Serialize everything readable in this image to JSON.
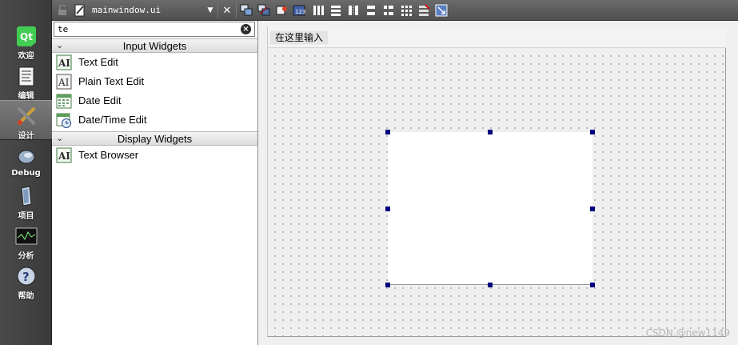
{
  "modes": [
    {
      "label": "欢迎",
      "icon": "qt-logo-icon"
    },
    {
      "label": "编辑",
      "icon": "document-icon"
    },
    {
      "label": "设计",
      "icon": "design-tools-icon"
    },
    {
      "label": "Debug",
      "icon": "bug-icon"
    },
    {
      "label": "项目",
      "icon": "project-icon"
    },
    {
      "label": "分析",
      "icon": "oscilloscope-icon"
    },
    {
      "label": "帮助",
      "icon": "help-icon"
    }
  ],
  "toolbar": {
    "document_name": "mainwindow.ui",
    "close_label": "✕"
  },
  "widgetbox": {
    "filter_value": "te",
    "categories": [
      {
        "label": "Input Widgets",
        "items": [
          {
            "label": "Text Edit",
            "icon": "text-edit-icon"
          },
          {
            "label": "Plain Text Edit",
            "icon": "plain-text-edit-icon"
          },
          {
            "label": "Date Edit",
            "icon": "date-edit-icon"
          },
          {
            "label": "Date/Time Edit",
            "icon": "datetime-edit-icon"
          }
        ]
      },
      {
        "label": "Display Widgets",
        "items": [
          {
            "label": "Text Browser",
            "icon": "text-browser-icon"
          }
        ]
      }
    ]
  },
  "form": {
    "menu_entry": "在这里输入"
  },
  "watermark": "CSDN @new1149"
}
